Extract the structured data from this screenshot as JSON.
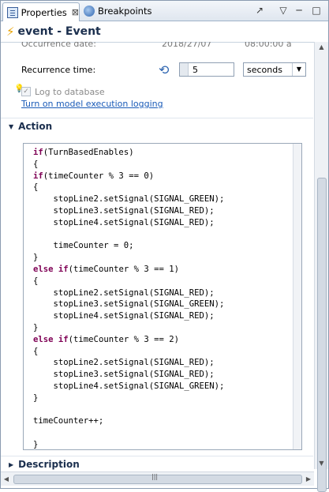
{
  "tabs": [
    {
      "label": "Properties",
      "close": "⊠"
    },
    {
      "label": "Breakpoints"
    }
  ],
  "header": {
    "title": "event - Event"
  },
  "occurrence": {
    "label": "Occurrence date:",
    "date": "2018/27/07",
    "time": "08:00:00 a"
  },
  "recurrence": {
    "label": "Recurrence time:",
    "value": "5",
    "unit": "seconds"
  },
  "logging": {
    "checkbox_label": "Log to database",
    "checked": true,
    "link": "Turn on model execution logging"
  },
  "sections": {
    "action": "Action",
    "description": "Description"
  },
  "code_lines": [
    "if(TurnBasedEnables)",
    "{",
    "if(timeCounter % 3 == 0)",
    "{",
    "    stopLine2.setSignal(SIGNAL_GREEN);",
    "    stopLine3.setSignal(SIGNAL_RED);",
    "    stopLine4.setSignal(SIGNAL_RED);",
    "",
    "    timeCounter = 0;",
    "}",
    "else if(timeCounter % 3 == 1)",
    "{",
    "    stopLine2.setSignal(SIGNAL_RED);",
    "    stopLine3.setSignal(SIGNAL_GREEN);",
    "    stopLine4.setSignal(SIGNAL_RED);",
    "}",
    "else if(timeCounter % 3 == 2)",
    "{",
    "    stopLine2.setSignal(SIGNAL_RED);",
    "    stopLine3.setSignal(SIGNAL_RED);",
    "    stopLine4.setSignal(SIGNAL_GREEN);",
    "}",
    "",
    "timeCounter++;",
    "",
    "}"
  ],
  "icons": {
    "event": "lightning-icon",
    "recurrence": "refresh-icon",
    "hint": "lightbulb-icon"
  },
  "colors": {
    "keyword": "#7f0055",
    "link": "#1a5bb8",
    "title": "#1b2f4e",
    "event_icon": "#e8a200"
  }
}
